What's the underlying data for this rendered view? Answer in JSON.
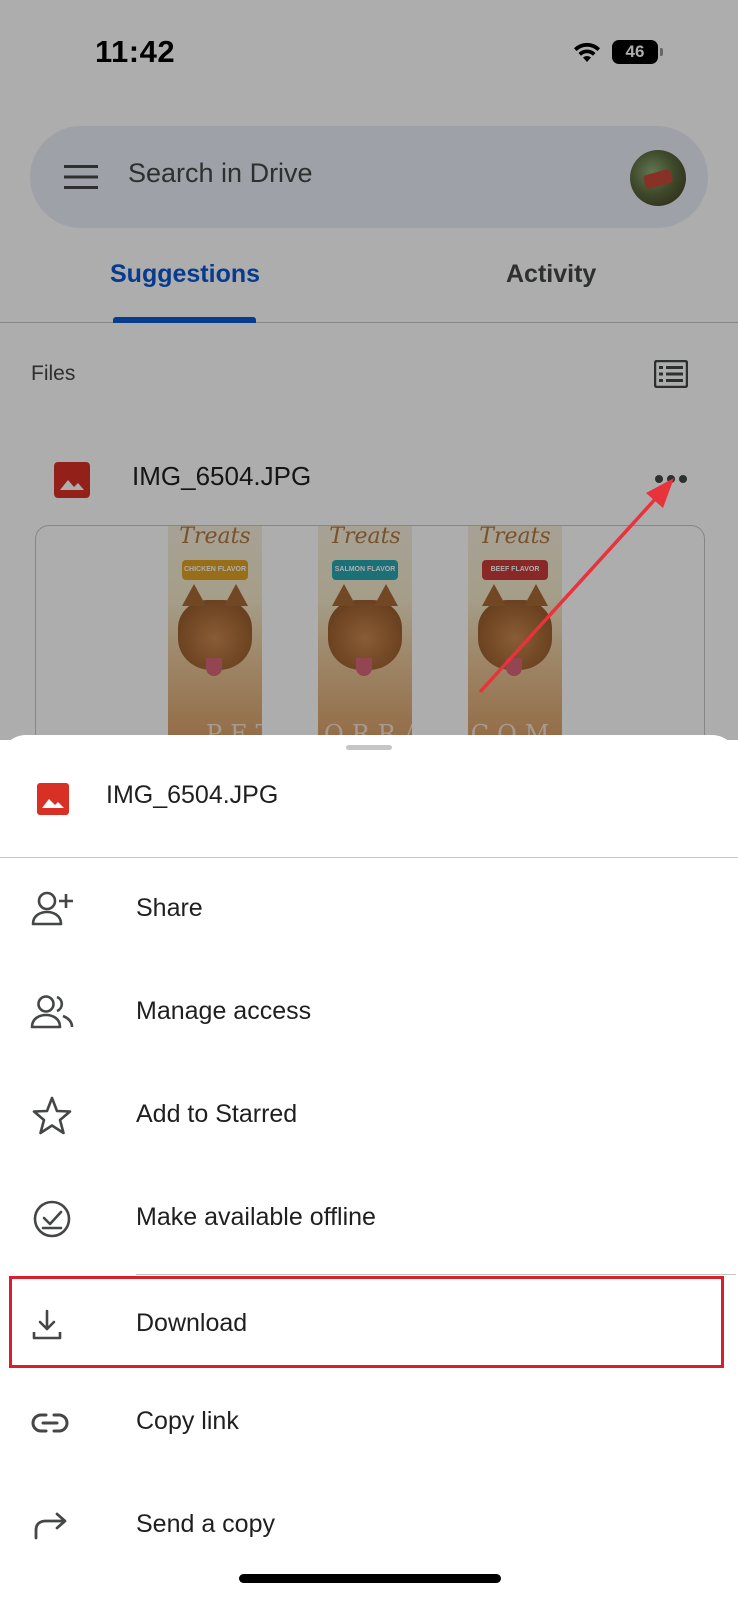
{
  "status_bar": {
    "time": "11:42",
    "battery": "46"
  },
  "search": {
    "placeholder": "Search in Drive"
  },
  "tabs": [
    {
      "label": "Suggestions",
      "active": true
    },
    {
      "label": "Activity",
      "active": false
    }
  ],
  "files_section": {
    "label": "Files"
  },
  "file_card": {
    "name": "IMG_6504.JPG",
    "preview_brand": "Treats",
    "preview_flavors": [
      "CHICKEN FLAVOR",
      "SALMON FLAVOR",
      "BEEF FLAVOR"
    ],
    "watermark": "PET-WORRAK.COM"
  },
  "bottom_sheet": {
    "file_name": "IMG_6504.JPG",
    "items": [
      {
        "label": "Share",
        "icon": "person-add-icon"
      },
      {
        "label": "Manage access",
        "icon": "people-icon"
      },
      {
        "label": "Add to Starred",
        "icon": "star-icon"
      },
      {
        "label": "Make available offline",
        "icon": "offline-check-icon"
      },
      {
        "label": "Download",
        "icon": "download-icon",
        "highlighted": true
      },
      {
        "label": "Copy link",
        "icon": "link-icon"
      },
      {
        "label": "Send a copy",
        "icon": "forward-icon"
      }
    ]
  },
  "colors": {
    "accent": "#0b57d0",
    "image_icon": "#d93025",
    "highlight": "#d7202b",
    "arrow": "#e8323c"
  }
}
